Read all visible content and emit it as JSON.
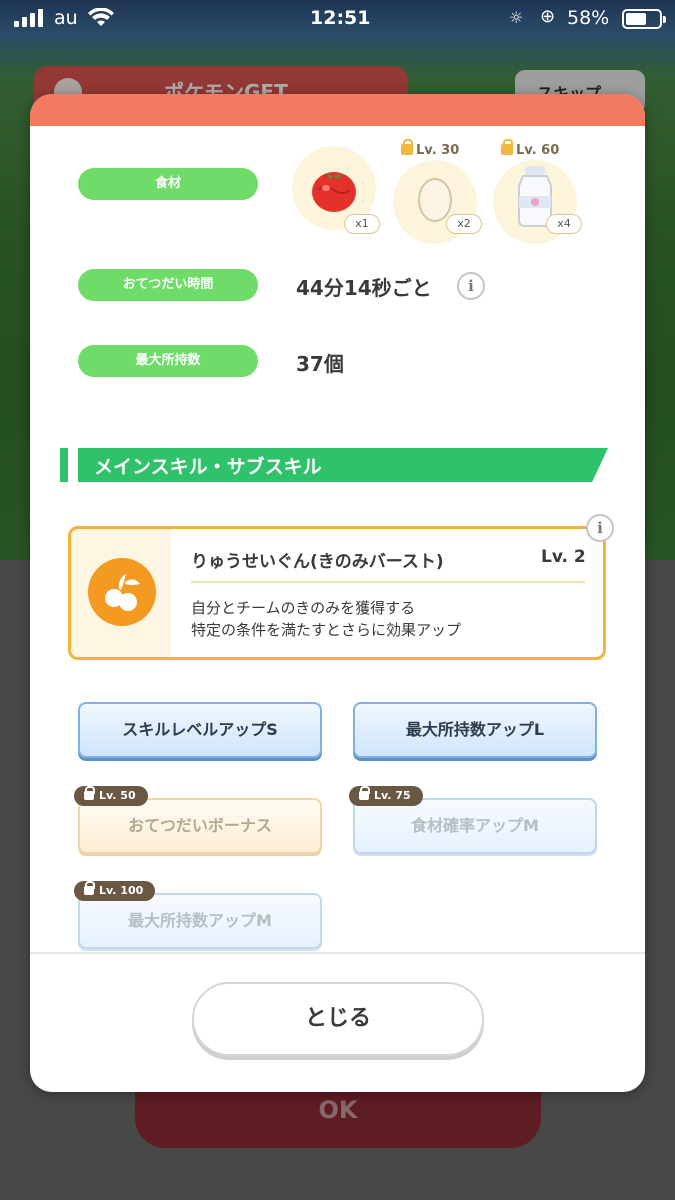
{
  "status_bar": {
    "carrier": "au",
    "time": "12:51",
    "battery": "58%"
  },
  "background": {
    "header_title": "ポケモンGET",
    "skip_label": "スキップ",
    "ok_label": "OK"
  },
  "ingredients": {
    "label": "食材",
    "items": [
      {
        "name": "tomato-icon",
        "count": "x1",
        "lock": ""
      },
      {
        "name": "egg-icon",
        "count": "x2",
        "lock": "Lv. 30"
      },
      {
        "name": "milk-icon",
        "count": "x4",
        "lock": "Lv. 60"
      }
    ]
  },
  "help_time": {
    "label": "おてつだい時間",
    "value": "44分14秒ごと"
  },
  "max_carry": {
    "label": "最大所持数",
    "value": "37個"
  },
  "section_title": "メインスキル・サブスキル",
  "main_skill": {
    "name": "りゅうせいぐん(きのみバースト)",
    "level": "Lv. 2",
    "desc_line1": "自分とチームのきのみを獲得する",
    "desc_line2": "特定の条件を満たすとさらに効果アップ"
  },
  "sub_skills": [
    {
      "label": "スキルレベルアップS",
      "lock": ""
    },
    {
      "label": "最大所持数アップL",
      "lock": ""
    },
    {
      "label": "おてつだいボーナス",
      "lock": "Lv. 50"
    },
    {
      "label": "食材確率アップM",
      "lock": "Lv. 75"
    },
    {
      "label": "最大所持数アップM",
      "lock": "Lv. 100"
    }
  ],
  "close_label": "とじる"
}
